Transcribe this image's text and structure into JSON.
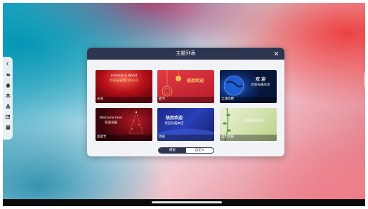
{
  "dialog": {
    "title": "主题列表",
    "close_icon": "close-icon"
  },
  "themes": [
    {
      "label": "光泽",
      "line1": "Internet & World",
      "line2": "欢迎莅临我们的公司"
    },
    {
      "label": "春节",
      "line1": "热烈欢迎"
    },
    {
      "label": "全球招聘",
      "line1": "欢 迎",
      "line2": "欢迎光临本店"
    },
    {
      "label": "圣诞节",
      "line1": "Welcome here",
      "line2": "欢迎光临"
    },
    {
      "label": "扬帆",
      "line1": "热烈欢迎",
      "line2": "欢迎光临本店"
    },
    {
      "label": "自然风格",
      "line1": "欢迎莅临本店"
    }
  ],
  "segment": {
    "options": [
      "模板",
      "自定义"
    ],
    "selected": "模板"
  },
  "toolbar": {
    "items": [
      "collapse-arrow-icon",
      "back-icon",
      "home-icon",
      "layers-icon",
      "stamp-icon",
      "edit-icon",
      "box-icon"
    ]
  },
  "colors": {
    "header": "#2e3550",
    "dialog_bg": "#f2f3f6"
  }
}
